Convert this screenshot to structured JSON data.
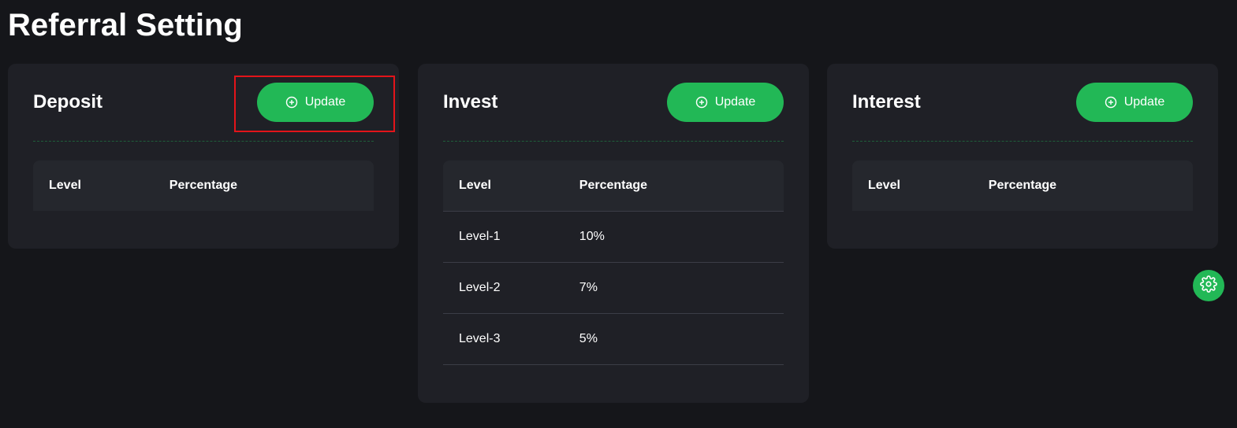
{
  "page": {
    "title": "Referral Setting"
  },
  "colors": {
    "background": "#15161a",
    "card": "#1f2026",
    "accent": "#22b856",
    "highlight": "#e3141a"
  },
  "cards": [
    {
      "title": "Deposit",
      "update_label": "Update",
      "update_icon": "plus-circle-icon",
      "highlighted": true,
      "columns": [
        "Level",
        "Percentage"
      ],
      "rows": []
    },
    {
      "title": "Invest",
      "update_label": "Update",
      "update_icon": "plus-circle-icon",
      "highlighted": false,
      "columns": [
        "Level",
        "Percentage"
      ],
      "rows": [
        {
          "level": "Level-1",
          "percentage": "10%"
        },
        {
          "level": "Level-2",
          "percentage": "7%"
        },
        {
          "level": "Level-3",
          "percentage": "5%"
        }
      ]
    },
    {
      "title": "Interest",
      "update_label": "Update",
      "update_icon": "plus-circle-icon",
      "highlighted": false,
      "columns": [
        "Level",
        "Percentage"
      ],
      "rows": []
    }
  ],
  "settings_fab": {
    "icon": "gear-icon"
  }
}
